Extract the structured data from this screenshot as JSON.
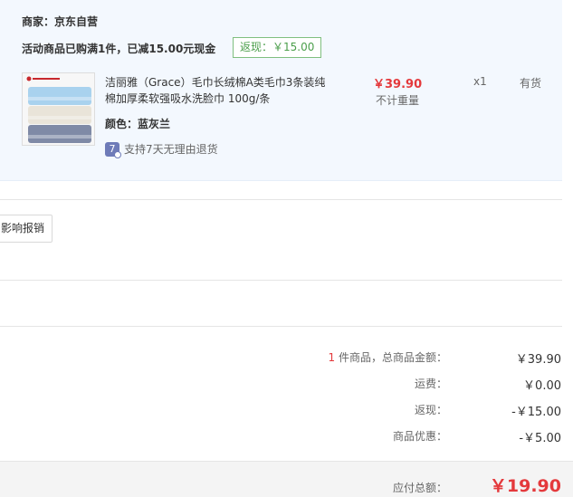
{
  "shop": {
    "seller_label": "商家：",
    "seller_name": "京东自营",
    "promo_text": "活动商品已购满1件，已减15.00元现金",
    "rebate_tag": "返现：￥15.00"
  },
  "item": {
    "name": "洁丽雅（Grace）毛巾长绒棉A类毛巾3条装纯棉加厚柔软强吸水洗脸巾 100g/条",
    "color_label": "颜色：",
    "color_value": "蓝灰兰",
    "return_icon_text": "7",
    "return_policy": "支持7天无理由退货",
    "price": "￥39.90",
    "weight_note": "不计重量",
    "quantity": "x1",
    "stock_status": "有货",
    "image_icon": "towel-stack-image"
  },
  "invoice": {
    "button_label": "影响报销"
  },
  "summary": {
    "item_count": "1",
    "total_label": " 件商品，总商品金额：",
    "total_value": "￥39.90",
    "shipping_label": "运费：",
    "shipping_value": "￥0.00",
    "rebate_label": "返现：",
    "rebate_value": "-￥15.00",
    "discount_label": "商品优惠：",
    "discount_value": "-￥5.00",
    "payable_label": "应付总额：",
    "payable_value": "￥19.90"
  },
  "colors": {
    "accent_red": "#e4393c",
    "panel_bg": "#f3f8fe",
    "rebate_green": "#4b9e4b"
  }
}
